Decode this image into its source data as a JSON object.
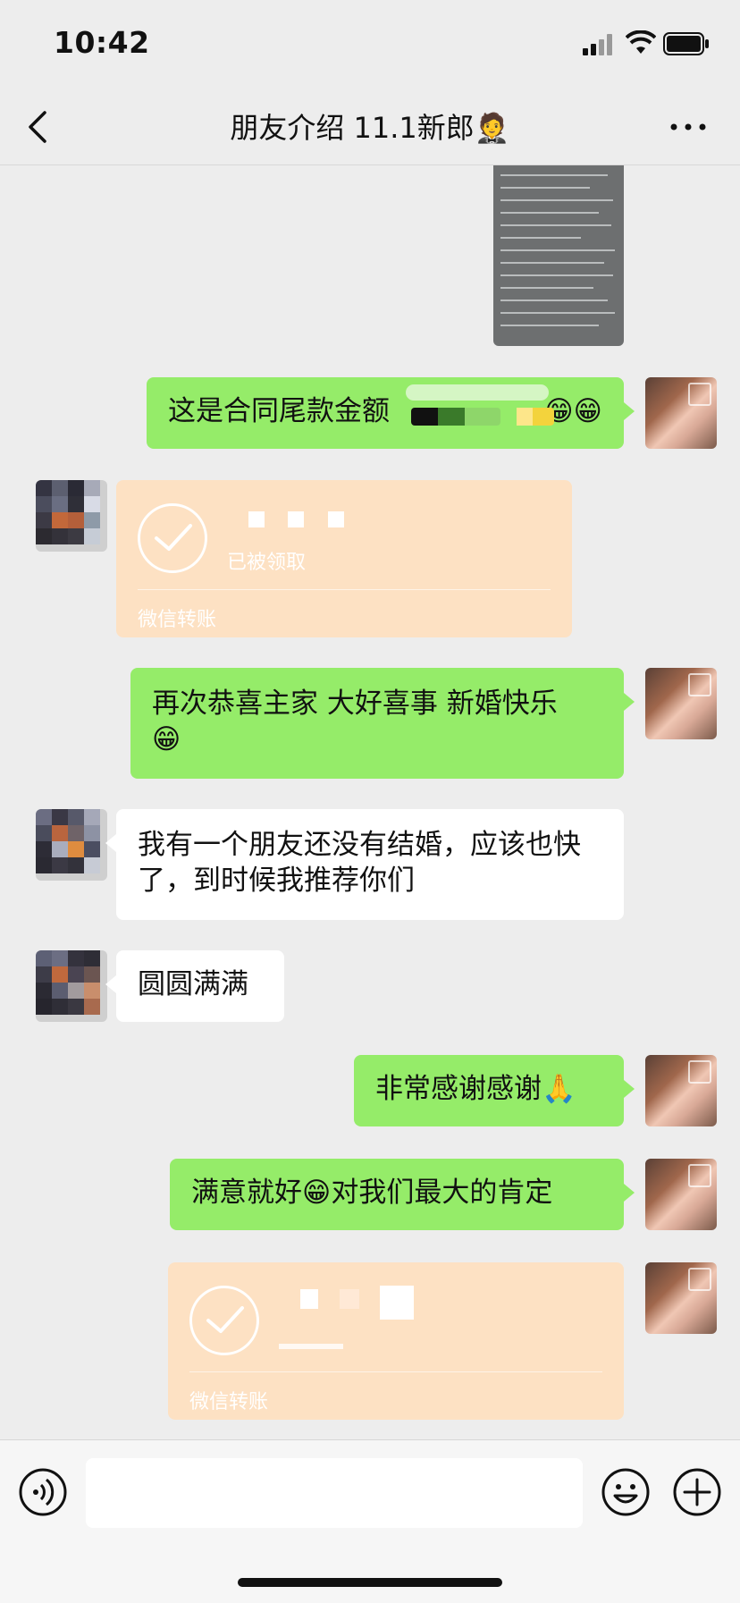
{
  "status_bar": {
    "time": "10:42"
  },
  "header": {
    "title": "朋友介绍 11.1新郎",
    "title_emoji": "🤵"
  },
  "messages": [
    {
      "id": "m1",
      "side": "right",
      "kind": "image",
      "content": "document-photo"
    },
    {
      "id": "m2",
      "side": "right",
      "kind": "text",
      "text": "这是合同尾款金额",
      "emoji": "😁😁"
    },
    {
      "id": "m3",
      "side": "left",
      "kind": "transfer",
      "status": "已被领取",
      "caption": "微信转账"
    },
    {
      "id": "m4",
      "side": "right",
      "kind": "text",
      "text": "再次恭喜主家 大好喜事 新婚快乐",
      "emoji": "😁"
    },
    {
      "id": "m5",
      "side": "left",
      "kind": "text",
      "text": "我有一个朋友还没有结婚，应该也快了，到时候我推荐你们"
    },
    {
      "id": "m6",
      "side": "left",
      "kind": "text",
      "text": "圆圆满满"
    },
    {
      "id": "m7",
      "side": "right",
      "kind": "text",
      "text": "非常感谢感谢",
      "emoji": "🙏"
    },
    {
      "id": "m8",
      "side": "right",
      "kind": "text",
      "text_a": "满意就好",
      "emoji": "😁",
      "text_b": "对我们最大的肯定"
    },
    {
      "id": "m9",
      "side": "right",
      "kind": "transfer",
      "caption": "微信转账"
    }
  ],
  "colors": {
    "chat_bg": "#ededed",
    "bubble_sent": "#95ec69",
    "bubble_received": "#ffffff",
    "transfer_bg": "#fde1c3"
  },
  "icons": {
    "back": "chevron-left-icon",
    "more": "ellipsis-icon",
    "voice": "voice-icon",
    "emoji": "smile-icon",
    "plus": "plus-icon"
  }
}
